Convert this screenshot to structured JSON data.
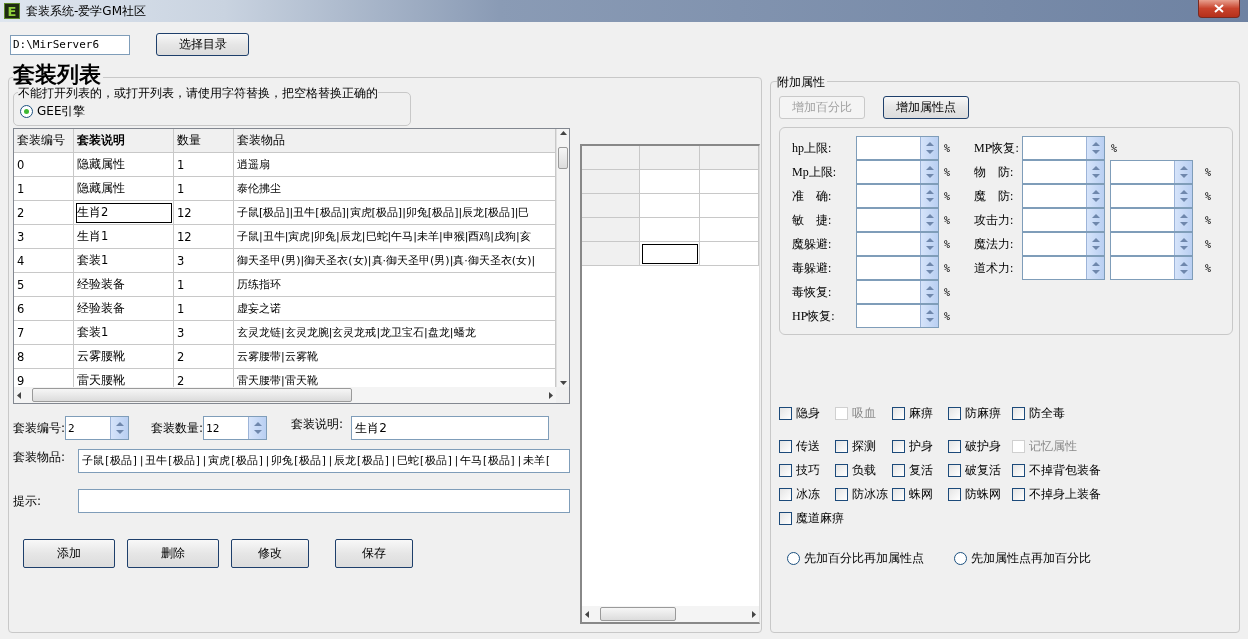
{
  "window": {
    "icon_letter": "E",
    "title": "套装系统-爱学GM社区"
  },
  "path": {
    "value": "D:\\MirServer6",
    "button": "选择目录"
  },
  "list_group": {
    "title": "套装列表"
  },
  "hint_group": {
    "title": "不能打开列表的，或打开列表，请使用字符替换，把空格替换正确的",
    "radio": {
      "label": "GEE引擎",
      "selected": true
    }
  },
  "table": {
    "columns": [
      "套装编号",
      "套装说明",
      "数量",
      "套装物品"
    ],
    "rows": [
      {
        "cells": [
          "0",
          "隐藏属性",
          "1",
          "逍遥扇"
        ],
        "selected": false
      },
      {
        "cells": [
          "1",
          "隐藏属性",
          "1",
          "泰伦拂尘"
        ],
        "selected": false
      },
      {
        "cells": [
          "2",
          "生肖2",
          "12",
          "子鼠[极品]|丑牛[极品]|寅虎[极品]|卯兔[极品]|辰龙[极品]|巳"
        ],
        "selected": true
      },
      {
        "cells": [
          "3",
          "生肖1",
          "12",
          "子鼠|丑牛|寅虎|卯兔|辰龙|巳蛇|午马|未羊|申猴|酉鸡|戌狗|亥"
        ],
        "selected": false
      },
      {
        "cells": [
          "4",
          "套装1",
          "3",
          "御天圣甲(男)|御天圣衣(女)|真·御天圣甲(男)|真·御天圣衣(女)|"
        ],
        "selected": false
      },
      {
        "cells": [
          "5",
          "经验装备",
          "1",
          "历练指环"
        ],
        "selected": false
      },
      {
        "cells": [
          "6",
          "经验装备",
          "1",
          "虚妄之诺"
        ],
        "selected": false
      },
      {
        "cells": [
          "7",
          "套装1",
          "3",
          "玄灵龙链|玄灵龙腕|玄灵龙戒|龙卫宝石|盘龙|蟠龙"
        ],
        "selected": false
      },
      {
        "cells": [
          "8",
          "云雾腰靴",
          "2",
          "云雾腰带|云雾靴"
        ],
        "selected": false
      },
      {
        "cells": [
          "9",
          "雷天腰靴",
          "2",
          "雷天腰带|雷天靴"
        ],
        "selected": false
      }
    ]
  },
  "side_grid": {
    "rows": [
      {
        "cells": [
          {
            "selected": false
          },
          {
            "selected": false
          }
        ]
      },
      {
        "cells": [
          {
            "selected": false
          },
          {
            "selected": false
          }
        ]
      },
      {
        "cells": [
          {
            "selected": false
          },
          {
            "selected": false
          }
        ]
      },
      {
        "cells": [
          {
            "selected": true
          },
          {
            "selected": false
          }
        ]
      }
    ]
  },
  "form": {
    "number": {
      "label": "套装编号:",
      "value": "2"
    },
    "count": {
      "label": "套装数量:",
      "value": "12"
    },
    "description": {
      "label": "套装说明:",
      "value": "生肖2"
    },
    "items": {
      "label": "套装物品:",
      "value": "子鼠[极品]|丑牛[极品]|寅虎[极品]|卯兔[极品]|辰龙[极品]|巳蛇[极品]|午马[极品]|未羊["
    },
    "tip": {
      "label": "提示:"
    }
  },
  "buttons": [
    "添加",
    "删除",
    "修改",
    "保存"
  ],
  "extra": {
    "title": "附加属性",
    "buttons": [
      {
        "label": "增加百分比",
        "disabled": true
      },
      {
        "label": "增加属性点",
        "disabled": false
      }
    ],
    "left_attrs": [
      {
        "label": "hp上限:",
        "unit": "%"
      },
      {
        "label": "Mp上限:",
        "unit": "%"
      },
      {
        "label": "准　确:",
        "unit": "%"
      },
      {
        "label": "敏　捷:",
        "unit": "%"
      },
      {
        "label": "魔躲避:",
        "unit": "%"
      },
      {
        "label": "毒躲避:",
        "unit": "%"
      },
      {
        "label": "毒恢复:",
        "unit": "%"
      },
      {
        "label": "HP恢复:",
        "unit": "%"
      }
    ],
    "right_attrs": [
      {
        "label": "MP恢复:",
        "kind": "single",
        "unit": "%"
      },
      {
        "label": "物　防:",
        "kind": "double",
        "unit": "%"
      },
      {
        "label": "魔　防:",
        "kind": "double",
        "unit": "%"
      },
      {
        "label": "攻击力:",
        "kind": "double",
        "unit": "%"
      },
      {
        "label": "魔法力:",
        "kind": "double",
        "unit": "%"
      },
      {
        "label": "道术力:",
        "kind": "double",
        "unit": "%"
      }
    ],
    "checkbox_rows": [
      [
        {
          "label": "隐身",
          "checked": false,
          "disabled": false
        },
        {
          "label": "吸血",
          "checked": false,
          "disabled": true
        },
        {
          "label": "麻痹",
          "checked": false,
          "disabled": false
        },
        {
          "label": "防麻痹",
          "checked": false,
          "disabled": false
        },
        {
          "label": "防全毒",
          "checked": false,
          "disabled": false
        }
      ],
      [
        {
          "label": "传送",
          "checked": false,
          "disabled": false
        },
        {
          "label": "探测",
          "checked": false,
          "disabled": false
        },
        {
          "label": "护身",
          "checked": false,
          "disabled": false
        },
        {
          "label": "破护身",
          "checked": false,
          "disabled": false
        },
        {
          "label": "记忆属性",
          "checked": false,
          "disabled": true
        }
      ],
      [
        {
          "label": "技巧",
          "checked": false,
          "disabled": false
        },
        {
          "label": "负载",
          "checked": false,
          "disabled": false
        },
        {
          "label": "复活",
          "checked": false,
          "disabled": false
        },
        {
          "label": "破复活",
          "checked": false,
          "disabled": false
        },
        {
          "label": "不掉背包装备",
          "checked": false,
          "disabled": false
        }
      ],
      [
        {
          "label": "冰冻",
          "checked": false,
          "disabled": false
        },
        {
          "label": "防冰冻",
          "checked": false,
          "disabled": false
        },
        {
          "label": "蛛网",
          "checked": false,
          "disabled": false
        },
        {
          "label": "防蛛网",
          "checked": false,
          "disabled": false
        },
        {
          "label": "不掉身上装备",
          "checked": false,
          "disabled": false
        }
      ],
      [
        {
          "label": "魔道麻痹",
          "checked": false,
          "disabled": false
        }
      ]
    ],
    "order_radios": [
      {
        "label": "先加百分比再加属性点",
        "selected": false
      },
      {
        "label": "先加属性点再加百分比",
        "selected": false
      }
    ]
  }
}
